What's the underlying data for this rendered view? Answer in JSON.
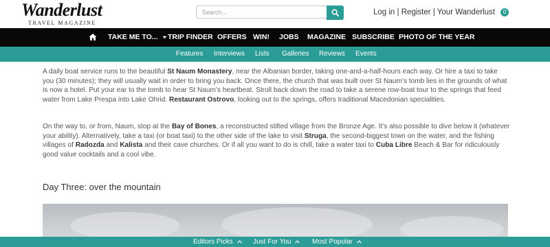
{
  "header": {
    "logo_text": "Wanderlust",
    "logo_sub": "TRAVEL MAGAZINE",
    "search_placeholder": "Search...",
    "login": "Log in",
    "register": "Register",
    "your_wanderlust": "Your Wanderlust",
    "sep": "|",
    "badge": "0"
  },
  "mainnav": {
    "items": [
      "TAKE ME TO...",
      "TRIP FINDER",
      "OFFERS",
      "WIN!",
      "JOBS",
      "MAGAZINE",
      "SUBSCRIBE",
      "PHOTO OF THE YEAR"
    ]
  },
  "subnav": {
    "items": [
      "Features",
      "Interviews",
      "Lists",
      "Galleries",
      "Reviews",
      "Events"
    ]
  },
  "article": {
    "p1": [
      "A daily boat service runs to the beautiful ",
      "St Naum Monastery",
      ", near the Albanian border, taking one-and-a-half-hours each way. Or hire a taxi to take you (30 minutes); they will usually wait in order to bring you back. Once there, the church that was built over St Naum’s tomb lies in the grounds of what is now a hotel. Put your ear to the tomb to hear St Naum’s heartbeat. Stroll back down the road to take a serene row-boat tour to the springs that feed water from Lake Prespa into Lake Ohrid. ",
      "Restaurant Ostrovo",
      ", looking out to the springs, offers traditional Macedonian specialities."
    ],
    "p2": [
      "On the way to, or from, Naum, stop at the ",
      "Bay of Bones",
      ", a reconstructed stilted village from the Bronze Age. It’s also possible to dive below it (whatever your ability). Alternatively, take a taxi (or boat taxi) to the other side of the lake to visit ",
      "Struga",
      ", the second-biggest town on the water, and the fishing villages of ",
      "Radozda",
      " and ",
      "Kalista",
      " and their cave churches. Or if all you want to do is chill, take a water taxi to ",
      "Cuba Libre",
      " Beach & Bar for ridiculously good value cocktails and a cool vibe."
    ],
    "heading": "Day Three: over the mountain"
  },
  "footer": {
    "items": [
      "Editors Picks",
      "Just For You",
      "Most Popular"
    ]
  },
  "colors": {
    "teal": "#2b9c96",
    "navbar": "#080808"
  }
}
